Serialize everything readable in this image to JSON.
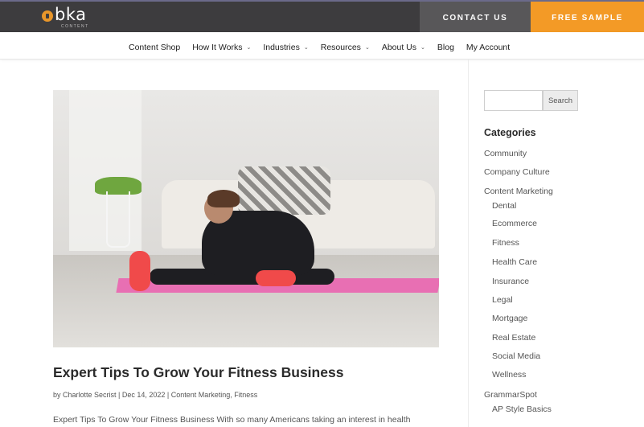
{
  "brand": {
    "logo_text": "bka",
    "logo_sub": "CONTENT"
  },
  "header": {
    "contact_label": "CONTACT US",
    "sample_label": "FREE SAMPLE"
  },
  "nav": {
    "items": [
      {
        "label": "Content Shop",
        "has_dropdown": false
      },
      {
        "label": "How It Works",
        "has_dropdown": true
      },
      {
        "label": "Industries",
        "has_dropdown": true
      },
      {
        "label": "Resources",
        "has_dropdown": true
      },
      {
        "label": "About Us",
        "has_dropdown": true
      },
      {
        "label": "Blog",
        "has_dropdown": false
      },
      {
        "label": "My Account",
        "has_dropdown": false
      }
    ],
    "chevron": "⌄"
  },
  "post": {
    "title": "Expert Tips To Grow Your Fitness Business",
    "meta": "by Charlotte Secrist | Dec 14, 2022 | Content Marketing, Fitness",
    "excerpt": "Expert Tips To Grow Your Fitness Business With so many Americans taking an interest in health"
  },
  "sidebar": {
    "search_placeholder": "",
    "search_label": "Search",
    "categories_heading": "Categories",
    "categories": [
      {
        "label": "Community",
        "indent": false
      },
      {
        "label": "Company Culture",
        "indent": false
      },
      {
        "label": "Content Marketing",
        "indent": false
      },
      {
        "label": "Dental",
        "indent": true
      },
      {
        "label": "Ecommerce",
        "indent": true
      },
      {
        "label": "Fitness",
        "indent": true
      },
      {
        "label": "Health Care",
        "indent": true
      },
      {
        "label": "Insurance",
        "indent": true
      },
      {
        "label": "Legal",
        "indent": true
      },
      {
        "label": "Mortgage",
        "indent": true
      },
      {
        "label": "Real Estate",
        "indent": true
      },
      {
        "label": "Social Media",
        "indent": true
      },
      {
        "label": "Wellness",
        "indent": true
      },
      {
        "label": "GrammarSpot",
        "indent": false
      },
      {
        "label": "AP Style Basics",
        "indent": true
      }
    ]
  },
  "colors": {
    "topbar": "#3d3c3e",
    "contact_bg": "#585759",
    "accent_orange": "#f39a26"
  }
}
